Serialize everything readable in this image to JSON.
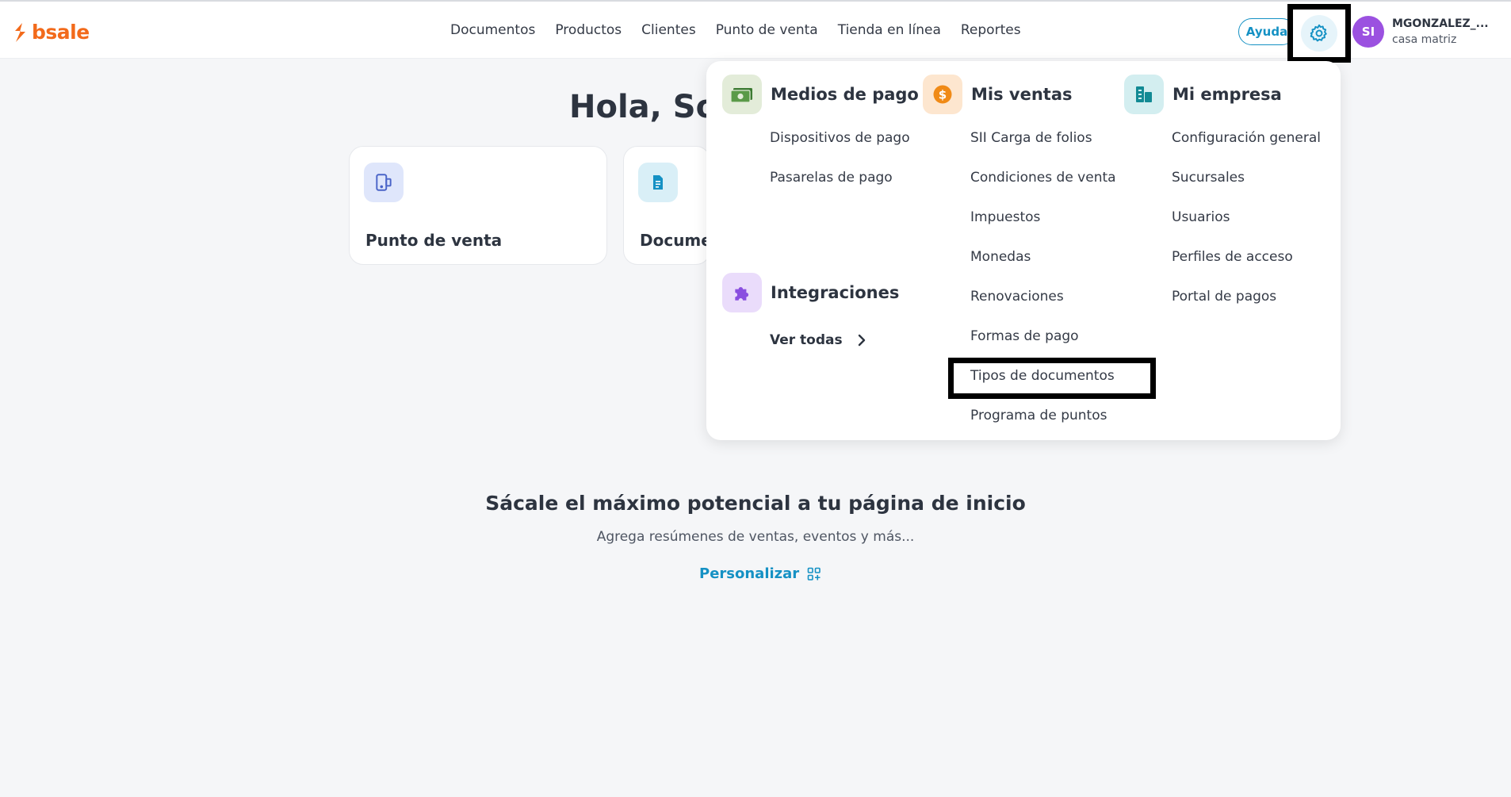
{
  "brand": {
    "name": "bsale",
    "color": "#f26a1b"
  },
  "nav": {
    "items": [
      "Documentos",
      "Productos",
      "Clientes",
      "Punto de venta",
      "Tienda en línea",
      "Reportes"
    ]
  },
  "header": {
    "help_label": "Ayuda",
    "settings_icon": "gear-icon",
    "avatar_initials": "SI",
    "user_name": "MGONZALEZ_...",
    "branch": "casa matriz"
  },
  "home": {
    "greeting": "Hola, Sop",
    "cards": [
      {
        "title": "Punto de venta",
        "icon": "pos-device-icon"
      },
      {
        "title": "Docume",
        "icon": "document-icon"
      }
    ],
    "promo_title": "Sácale el máximo potencial a tu página de inicio",
    "promo_subtitle": "Agrega resúmenes de ventas, eventos y más...",
    "personalize_label": "Personalizar"
  },
  "settings_menu": {
    "payment": {
      "title": "Medios de pago",
      "icon": "cash-icon",
      "links": [
        "Dispositivos de pago",
        "Pasarelas de pago"
      ]
    },
    "integrations": {
      "title": "Integraciones",
      "icon": "puzzle-icon",
      "see_all": "Ver todas"
    },
    "sales": {
      "title": "Mis ventas",
      "icon": "coin-icon",
      "links": [
        "SII Carga de folios",
        "Condiciones de venta",
        "Impuestos",
        "Monedas",
        "Renovaciones",
        "Formas de pago",
        "Tipos de documentos",
        "Programa de puntos"
      ]
    },
    "company": {
      "title": "Mi empresa",
      "icon": "building-icon",
      "links": [
        "Configuración general",
        "Sucursales",
        "Usuarios",
        "Perfiles de acceso",
        "Portal de pagos"
      ]
    }
  },
  "colors": {
    "accent": "#1591c4",
    "avatar": "#9b51e0",
    "payment_bg": "#e3ecd9",
    "sales_bg": "#fde6cf",
    "company_bg": "#d3eef0",
    "integrations_bg": "#eadcfb"
  }
}
